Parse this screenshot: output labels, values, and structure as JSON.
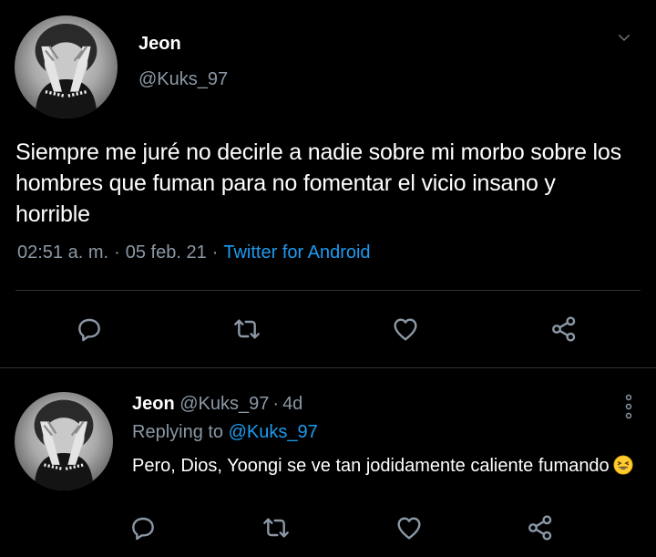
{
  "main_tweet": {
    "author_name": "Jeon",
    "handle": "@Kuks_97",
    "text": "Siempre me juré no decirle a nadie sobre mi morbo sobre los hombres que fuman para no fomentar el vicio insano y horrible",
    "time": "02:51 a. m.",
    "separator": "·",
    "date": "05 feb. 21",
    "source": "Twitter for Android"
  },
  "reply_tweet": {
    "author_name": "Jeon",
    "handle": "@Kuks_97",
    "separator": "·",
    "age": "4d",
    "replying_to_label": "Replying to",
    "replying_to_handle": "@Kuks_97",
    "text": "Pero, Dios, Yoongi se ve tan jodidamente caliente fumando"
  },
  "actions": {
    "reply_icon": "reply-icon",
    "retweet_icon": "retweet-icon",
    "like_icon": "heart-icon",
    "share_icon": "share-icon"
  },
  "colors": {
    "background": "#000000",
    "text": "#ffffff",
    "secondary": "#8b98a5",
    "accent": "#1d9bf0",
    "divider": "#2f3336"
  }
}
